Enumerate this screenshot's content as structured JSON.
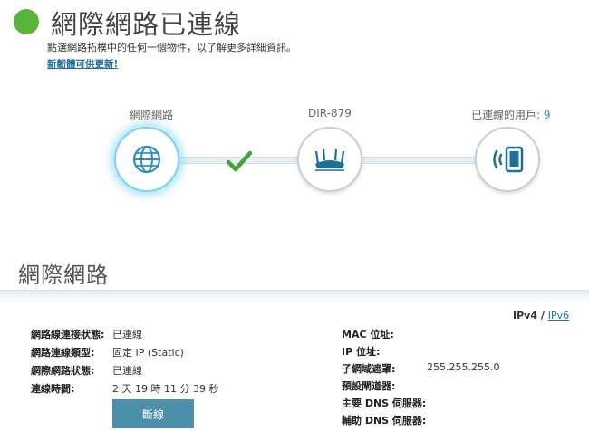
{
  "header": {
    "title": "網際網路已連線",
    "hint": "點選網路拓樸中的任何一個物件，以了解更多詳細資訊。",
    "update_link": "新韌體可供更新!",
    "status_color": "#57b63a"
  },
  "topology": {
    "internet_label": "網際網路",
    "router_label": "DIR-879",
    "clients_label": "已連線的用戶:",
    "clients_count": "9",
    "internet_icon": "globe-icon",
    "router_icon": "router-icon",
    "clients_icon": "wireless-device-icon",
    "status_icon": "checkmark-icon"
  },
  "section": {
    "title": "網際網路",
    "ipv4": "IPv4",
    "separator": "/",
    "ipv6": "IPv6"
  },
  "left_info": [
    {
      "key": "網路線連接狀態:",
      "value": "已連線"
    },
    {
      "key": "網路連線類型:",
      "value": "固定 IP (Static)"
    },
    {
      "key": "網際網路狀態:",
      "value": "已連線"
    },
    {
      "key": "連線時間:",
      "value": "2 天 19 時 11 分 39 秒"
    }
  ],
  "right_info": [
    {
      "key": "MAC 位址:",
      "value": ""
    },
    {
      "key": "IP 位址:",
      "value": ""
    },
    {
      "key": "子網域遮罩:",
      "value": "255.255.255.0"
    },
    {
      "key": "預設閘道器:",
      "value": ""
    },
    {
      "key": "主要 DNS 伺服器:",
      "value": ""
    },
    {
      "key": "輔助 DNS 伺服器:",
      "value": ""
    }
  ],
  "actions": {
    "disconnect_label": "斷線"
  }
}
